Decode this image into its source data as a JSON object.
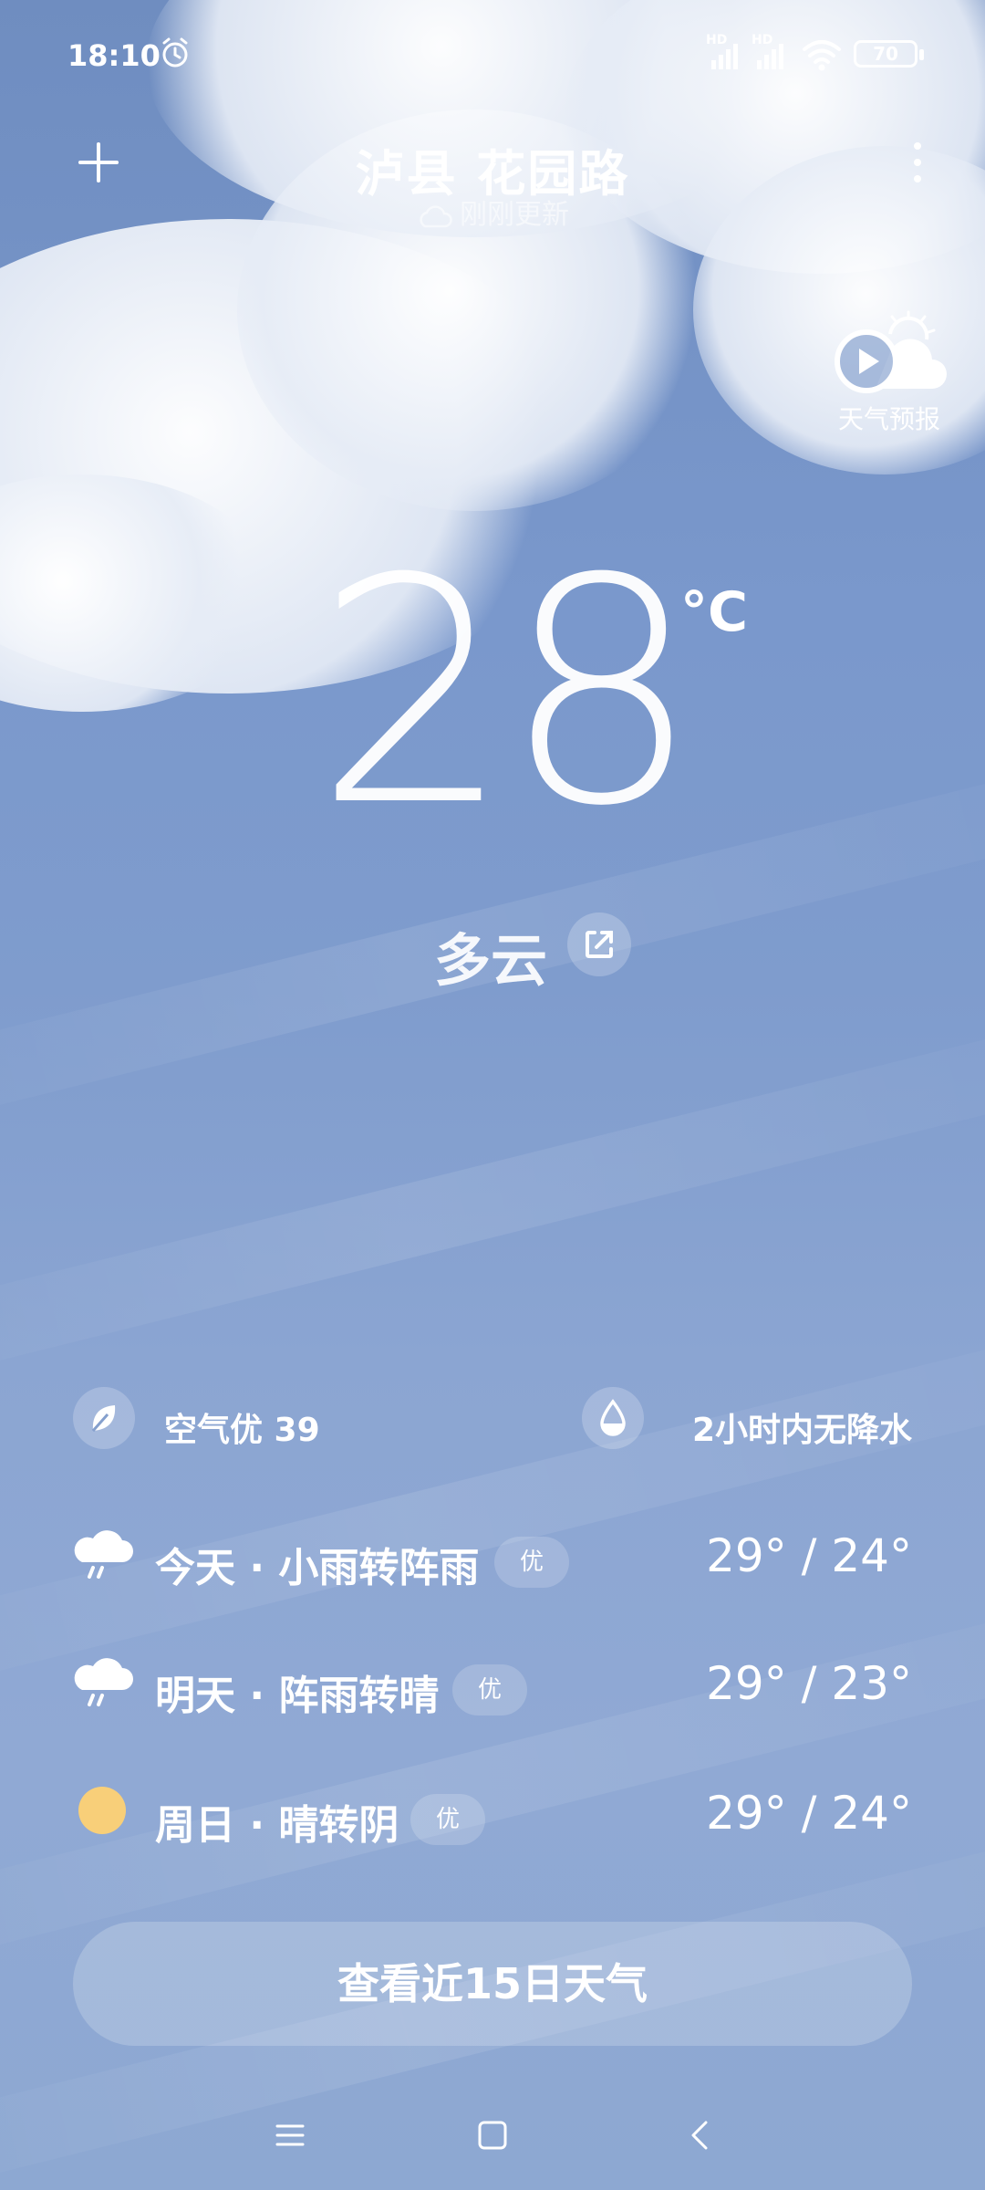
{
  "status_bar": {
    "time": "18:10",
    "battery": "70",
    "signal1_label": "HD",
    "signal2_label": "HD"
  },
  "header": {
    "location": "泸县 花园路",
    "updated": "刚刚更新"
  },
  "forecast_video": {
    "label": "天气预报"
  },
  "current": {
    "temperature": "28",
    "unit": "°C",
    "condition": "多云"
  },
  "info": {
    "air": "空气优 39",
    "rain": "2小时内无降水"
  },
  "daily": [
    {
      "label": "今天 · 小雨转阵雨",
      "aqi": "优",
      "range": "29° / 24°",
      "icon": "rain-cloud-icon"
    },
    {
      "label": "明天 · 阵雨转晴",
      "aqi": "优",
      "range": "29° / 23°",
      "icon": "rain-cloud-icon"
    },
    {
      "label": "周日 · 晴转阴",
      "aqi": "优",
      "range": "29° / 24°",
      "icon": "sun-icon"
    }
  ],
  "button_15day": "查看近15日天气",
  "colors": {
    "sky_top": "#6f8dc0",
    "sky_bottom": "#8da8d2",
    "sun": "#f8cf79"
  }
}
